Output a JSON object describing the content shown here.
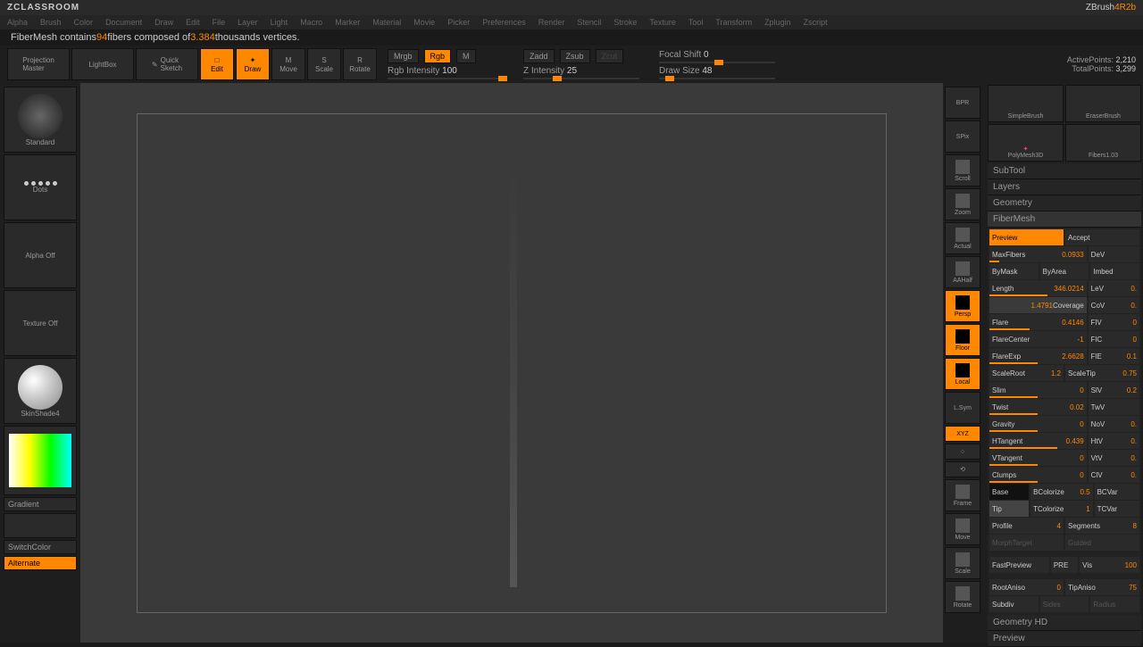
{
  "app": {
    "title": "ZCLASSROOM",
    "brand": "ZBrush",
    "version": "4R2b"
  },
  "menu": [
    "Alpha",
    "Brush",
    "Color",
    "Document",
    "Draw",
    "Edit",
    "File",
    "Layer",
    "Light",
    "Macro",
    "Marker",
    "Material",
    "Movie",
    "Picker",
    "Preferences",
    "Render",
    "Stencil",
    "Stroke",
    "Texture",
    "Tool",
    "Transform",
    "Zplugin",
    "Zscript"
  ],
  "status": {
    "prefix": "FiberMesh contains ",
    "fibers": "94",
    "mid": " fibers composed of ",
    "verts": "3.384",
    "suffix": " thousands vertices."
  },
  "toolbar": {
    "projection": "Projection\nMaster",
    "lightbox": "LightBox",
    "quicksketch": "Quick\nSketch",
    "edit": "Edit",
    "draw": "Draw",
    "move": "Move",
    "scale": "Scale",
    "rotate": "Rotate",
    "mrgb": "Mrgb",
    "rgb": "Rgb",
    "m": "M",
    "zadd": "Zadd",
    "zsub": "Zsub",
    "zcut": "Zcut",
    "rgbint": "Rgb Intensity",
    "rgbint_val": "100",
    "zint": "Z Intensity",
    "zint_val": "25",
    "focal": "Focal Shift",
    "focal_val": "0",
    "drawsize": "Draw Size",
    "drawsize_val": "48",
    "active": "ActivePoints:",
    "active_val": "2,210",
    "total": "TotalPoints:",
    "total_val": "3,299"
  },
  "left": {
    "brush": "Standard",
    "stroke": "Dots",
    "alpha": "Alpha Off",
    "texture": "Texture Off",
    "material": "SkinShade4",
    "gradient": "Gradient",
    "switchcolor": "SwitchColor",
    "alternate": "Alternate"
  },
  "rtool": {
    "bpr": "BPR",
    "spix": "SPix",
    "scroll": "Scroll",
    "zoom": "Zoom",
    "actual": "Actual",
    "aahalf": "AAHalf",
    "persp": "Persp",
    "floor": "Floor",
    "local": "Local",
    "xyz": "XYZ",
    "frame": "Frame",
    "move": "Move",
    "scale": "Scale",
    "rotate": "Rotate",
    "lsym": "L.Sym"
  },
  "rp": {
    "tools": [
      "SimpleBrush",
      "EraserBrush",
      "PolyMesh3D",
      "Fibers1.03"
    ],
    "sections": {
      "subtool": "SubTool",
      "layers": "Layers",
      "geometry": "Geometry",
      "fibermesh": "FiberMesh",
      "geohd": "Geometry HD",
      "preview": "Preview"
    },
    "fm": {
      "preview": "Preview",
      "accept": "Accept",
      "maxfibers": "MaxFibers",
      "maxfibers_val": "0.0933",
      "dev": "DeV",
      "bymask": "ByMask",
      "byarea": "ByArea",
      "imbed": "Imbed",
      "length": "Length",
      "length_val": "346.0214",
      "lev": "LeV",
      "lev_val": "0.",
      "coverage": "Coverage",
      "coverage_val": "1.4791",
      "cov": "CoV",
      "cov_val": "0.",
      "flare": "Flare",
      "flare_val": "0.4146",
      "flv": "FlV",
      "flv_val": "0",
      "flarecenter": "FlareCenter",
      "flarecenter_val": "-1",
      "flc": "FlC",
      "flc_val": "0",
      "flareexp": "FlareExp",
      "flareexp_val": "2.6628",
      "fle": "FlE",
      "fle_val": "0.1",
      "scaleroot": "ScaleRoot",
      "scaleroot_val": "1.2",
      "scaletip": "ScaleTip",
      "scaletip_val": "0.75",
      "slim": "Slim",
      "slim_val": "0",
      "slv": "SlV",
      "slv_val": "0.2",
      "twist": "Twist",
      "twist_val": "0.02",
      "twv": "TwV",
      "gravity": "Gravity",
      "gravity_val": "0",
      "nov": "NoV",
      "nov_val": "0.",
      "htangent": "HTangent",
      "htangent_val": "0.439",
      "htv": "HtV",
      "htv_val": "0.",
      "vtangent": "VTangent",
      "vtangent_val": "0",
      "vtv": "VtV",
      "vtv_val": "0.",
      "clumps": "Clumps",
      "clumps_val": "0",
      "clv": "ClV",
      "clv_val": "0.",
      "base": "Base",
      "bcolorize": "BColorize",
      "bcolorize_val": "0.5",
      "bcvar": "BCVar",
      "tip": "Tip",
      "tcolorize": "TColorize",
      "tcolorize_val": "1",
      "tcvar": "TCVar",
      "profile": "Profile",
      "profile_val": "4",
      "segments": "Segments",
      "segments_val": "8",
      "morphtarget": "MorphTarget",
      "guided": "Guided",
      "fastpreview": "FastPreview",
      "pre": "PRE",
      "vis": "Vis",
      "vis_val": "100",
      "rootaniso": "RootAniso",
      "rootaniso_val": "0",
      "tipaniso": "TipAniso",
      "tipaniso_val": "75",
      "subdiv": "Subdiv",
      "sides": "Sides",
      "radius": "Radius"
    }
  }
}
